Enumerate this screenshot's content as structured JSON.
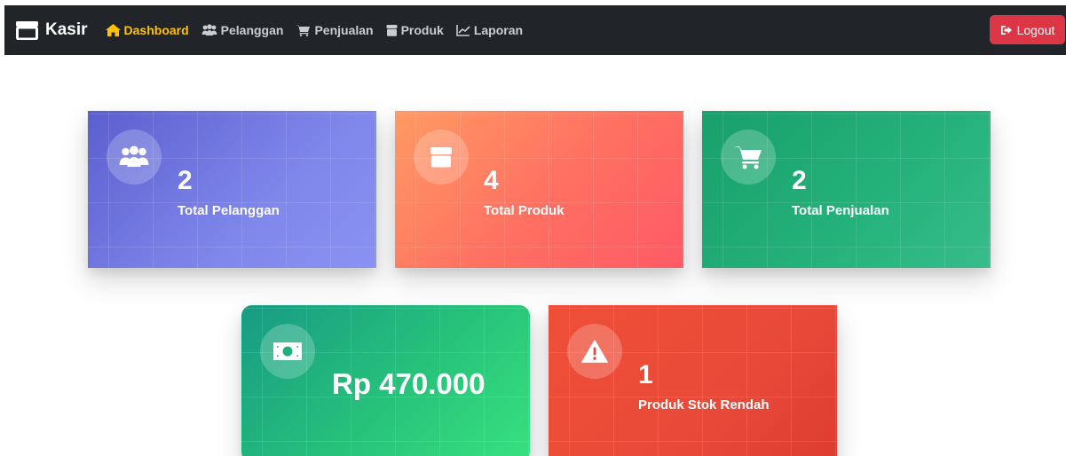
{
  "navbar": {
    "brand": "Kasir",
    "links": [
      {
        "label": "Dashboard",
        "icon": "home-icon",
        "active": true
      },
      {
        "label": "Pelanggan",
        "icon": "users-icon",
        "active": false
      },
      {
        "label": "Penjualan",
        "icon": "cart-icon",
        "active": false
      },
      {
        "label": "Produk",
        "icon": "box-icon",
        "active": false
      },
      {
        "label": "Laporan",
        "icon": "chart-line-icon",
        "active": false
      }
    ],
    "logout_label": "Logout"
  },
  "cards": [
    {
      "value": "2",
      "label": "Total Pelanggan",
      "icon": "users-icon"
    },
    {
      "value": "4",
      "label": "Total Produk",
      "icon": "box-icon"
    },
    {
      "value": "2",
      "label": "Total Penjualan",
      "icon": "cart-icon"
    },
    {
      "value": "Rp 470.000",
      "label": "",
      "icon": "money-icon"
    },
    {
      "value": "1",
      "label": "Produk Stok Rendah",
      "icon": "warning-icon"
    }
  ],
  "colors": {
    "navbar_bg": "#212529",
    "active_link": "#ffc107",
    "logout_bg": "#dc3545"
  }
}
